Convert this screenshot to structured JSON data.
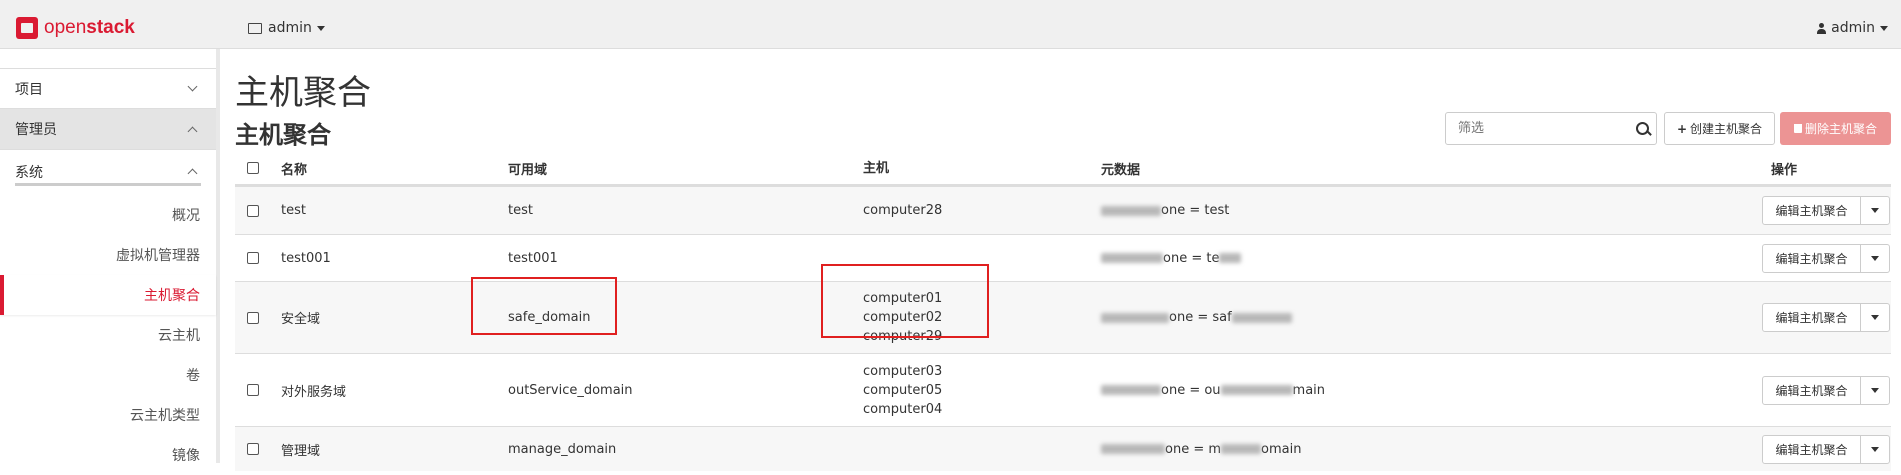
{
  "header": {
    "logo_text_open": "open",
    "logo_text_stack": "stack",
    "project_label": "admin",
    "user_label": "admin"
  },
  "sidebar": {
    "sections": [
      {
        "label": "项目"
      },
      {
        "label": "管理员"
      }
    ],
    "sub": {
      "label": "系统"
    },
    "items": [
      {
        "label": "概况"
      },
      {
        "label": "虚拟机管理器"
      },
      {
        "label": "主机聚合"
      },
      {
        "label": "云主机"
      },
      {
        "label": "卷"
      },
      {
        "label": "云主机类型"
      },
      {
        "label": "镜像"
      }
    ]
  },
  "main": {
    "page_title": "主机聚合",
    "section_title": "主机聚合",
    "filter_placeholder": "筛选",
    "create_label": "创建主机聚合",
    "delete_label": "删除主机聚合"
  },
  "table": {
    "columns": [
      "名称",
      "可用域",
      "主机",
      "元数据",
      "操作"
    ],
    "rows": [
      {
        "name": "test",
        "zone": "test",
        "hosts": [
          "computer28"
        ],
        "meta_tail": "one = test",
        "action": "编辑主机聚合"
      },
      {
        "name": "test001",
        "zone": "test001",
        "hosts": [],
        "meta_tail": "one = te",
        "action": "编辑主机聚合"
      },
      {
        "name": "安全域",
        "zone": "safe_domain",
        "hosts": [
          "computer01",
          "computer02",
          "computer29"
        ],
        "meta_tail": "one = saf",
        "action": "编辑主机聚合"
      },
      {
        "name": "对外服务域",
        "zone": "outService_domain",
        "hosts": [
          "computer03",
          "computer05",
          "computer04"
        ],
        "meta_tail": "one = ou",
        "meta_end": "main",
        "action": "编辑主机聚合"
      },
      {
        "name": "管理域",
        "zone": "manage_domain",
        "hosts": [],
        "meta_tail": "one = m",
        "meta_end": "omain",
        "action": "编辑主机聚合"
      }
    ]
  },
  "colors": {
    "brand": "#da1a32",
    "delete_button": "#ec9494",
    "highlight_box": "#e02020"
  }
}
